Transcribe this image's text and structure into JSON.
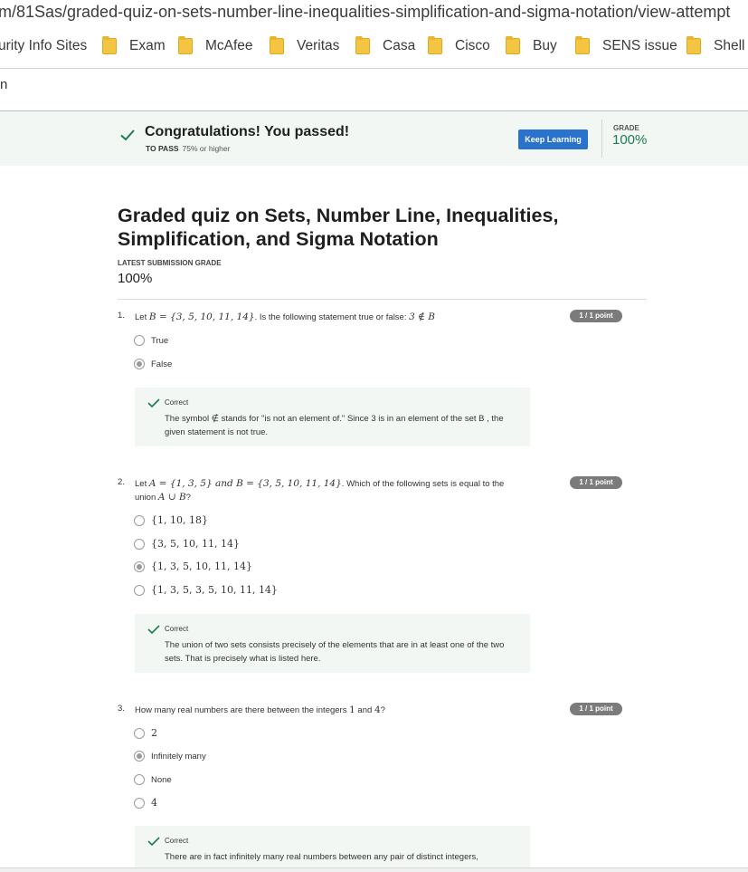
{
  "browser": {
    "url": "m/81Sas/graded-quiz-on-sets-number-line-inequalities-simplification-and-sigma-notation/view-attempt",
    "bookmarks": [
      {
        "label": "urity Info Sites",
        "folder": false
      },
      {
        "label": "Exam",
        "folder": true
      },
      {
        "label": "McAfee",
        "folder": true
      },
      {
        "label": "Veritas",
        "folder": true
      },
      {
        "label": "Casa",
        "folder": true
      },
      {
        "label": "Cisco",
        "folder": true
      },
      {
        "label": "Buy",
        "folder": true
      },
      {
        "label": "SENS issue",
        "folder": true
      },
      {
        "label": "Shell",
        "folder": true
      }
    ],
    "tab_fragment": "n"
  },
  "banner": {
    "message": "Congratulations! You passed!",
    "to_pass_label": "TO PASS",
    "to_pass_value": "75% or higher",
    "keep_learning": "Keep Learning",
    "grade_label": "GRADE",
    "grade_value": "100%"
  },
  "quiz": {
    "title": "Graded quiz on Sets, Number Line, Inequalities, Simplification, and Sigma Notation",
    "latest_label": "LATEST SUBMISSION GRADE",
    "latest_value": "100%"
  },
  "questions": [
    {
      "number": "1.",
      "text_pre": "Let ",
      "math1": "B = {3, 5, 10, 11, 14}",
      "text_mid": ". Is the following statement true or false: ",
      "math2": "3 ∉ B",
      "points": "1 / 1 point",
      "options": [
        "True",
        "False"
      ],
      "selected": 1,
      "feedback_title": "Correct",
      "feedback_text": "The symbol ∉ stands for \"is not an element of.\" Since 3 is in an element of the set B , the given statement is not true."
    },
    {
      "number": "2.",
      "text_pre": "Let ",
      "math1": "A = {1, 3, 5} and B = {3, 5, 10, 11, 14}",
      "text_mid": ". Which of the following sets is equal to the union ",
      "math2": "A ∪ B",
      "text_post": "?",
      "points": "1 / 1 point",
      "options": [
        "{1, 10, 18}",
        "{3, 5, 10, 11, 14}",
        "{1, 3, 5, 10, 11, 14}",
        "{1, 3, 5, 3, 5, 10, 11, 14}"
      ],
      "selected": 2,
      "feedback_title": "Correct",
      "feedback_text": "The union of two sets consists precisely of the elements that are in at least one of the two sets. That is precisely what is listed here."
    },
    {
      "number": "3.",
      "text_pre": "How many real numbers are there between the integers ",
      "math1": "1",
      "text_mid": " and ",
      "math2": "4",
      "text_post": "?",
      "points": "1 / 1 point",
      "options": [
        "2",
        "Infinitely many",
        "None",
        "4"
      ],
      "selected": 1,
      "feedback_title": "Correct",
      "feedback_text": "There are in fact infinitely many real numbers between any pair of distinct integers,"
    }
  ]
}
